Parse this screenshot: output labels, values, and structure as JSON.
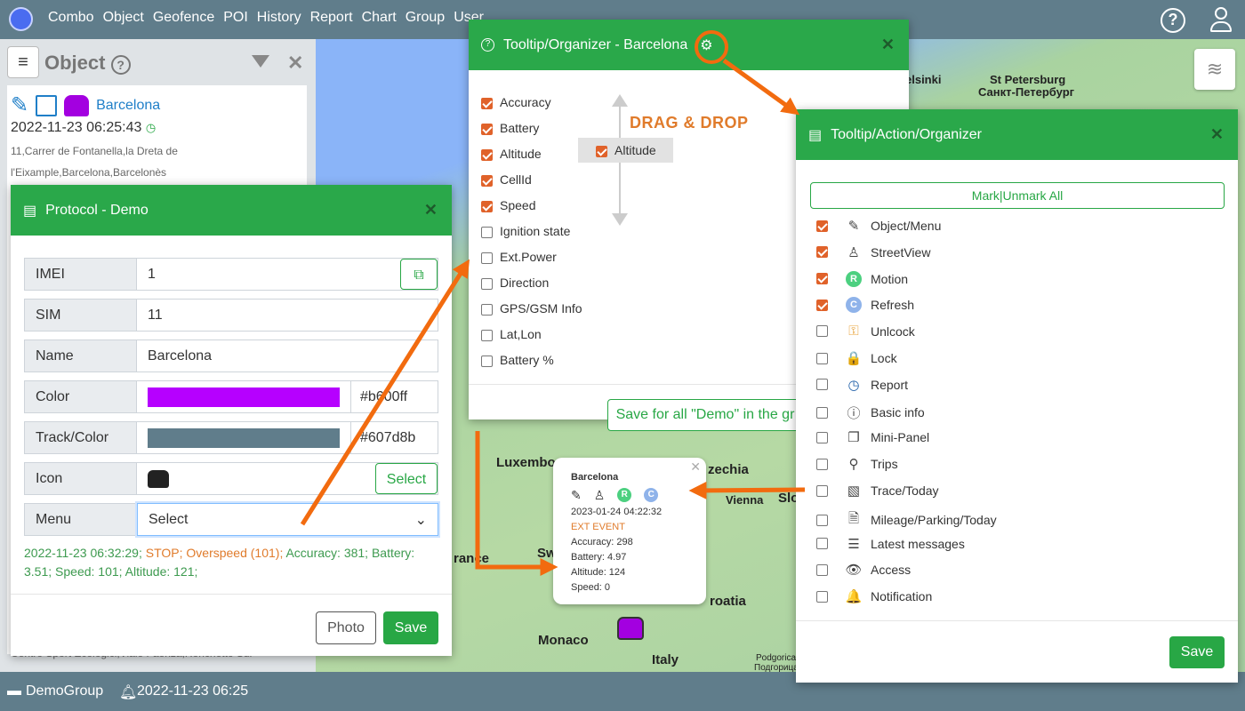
{
  "topbar": {
    "nav": [
      "Combo",
      "Object",
      "Geofence",
      "POI",
      "History",
      "Report",
      "Chart",
      "Group",
      "User"
    ]
  },
  "left": {
    "title": "Object",
    "object_name": "Barcelona",
    "object_time": "2022-11-23 06:25:43",
    "address": "11,Carrer de Fontanella,la Dreta de l'Eixample,Barcelona,Barcelonès",
    "address2": "Centro Sport Ecologici,Viale Faenza,Ronchetto Sul"
  },
  "map": {
    "labels": [
      "elsinki",
      "St Petersburg",
      "Санкт-Петербург",
      "Luxembo",
      "zechia",
      "Vienna",
      "Slo",
      "Monaco",
      "Italy",
      "roatia",
      "Sw",
      "rance",
      "Podgorica",
      "Подгорица"
    ]
  },
  "protocol": {
    "title": "Protocol - Demo",
    "rows": [
      {
        "label": "IMEI",
        "value": "1"
      },
      {
        "label": "SIM",
        "value": "11"
      },
      {
        "label": "Name",
        "value": "Barcelona"
      },
      {
        "label": "Color",
        "value": "#b600ff",
        "swatch": "#b600ff"
      },
      {
        "label": "Track/Color",
        "value": "#607d8b",
        "swatch": "#607d8b"
      },
      {
        "label": "Icon",
        "button": "Select"
      },
      {
        "label": "Menu",
        "value": "Select"
      }
    ],
    "status_time": "2022-11-23 06:32:29;",
    "status_alert": "STOP; Overspeed (101);",
    "status_rest": "Accuracy: 381; Battery: 3.51; Speed: 101; Altitude: 121;",
    "photo": "Photo",
    "save": "Save"
  },
  "organizer": {
    "title": "Tooltip/Organizer - Barcelona",
    "drag_label": "DRAG & DROP",
    "drag_item": "Altitude",
    "items": [
      {
        "label": "Accuracy",
        "checked": true
      },
      {
        "label": "Battery",
        "checked": true
      },
      {
        "label": "Altitude",
        "checked": true
      },
      {
        "label": "CellId",
        "checked": true
      },
      {
        "label": "Speed",
        "checked": true
      },
      {
        "label": "Ignition state",
        "checked": false
      },
      {
        "label": "Ext.Power",
        "checked": false
      },
      {
        "label": "Direction",
        "checked": false
      },
      {
        "label": "GPS/GSM Info",
        "checked": false
      },
      {
        "label": "Lat,Lon",
        "checked": false
      },
      {
        "label": "Battery %",
        "checked": false
      }
    ],
    "save_all": "Save for all \"Demo\" in the gr"
  },
  "action": {
    "title": "Tooltip/Action/Organizer",
    "mark_all": "Mark|Unmark All",
    "save": "Save",
    "items": [
      {
        "label": "Object/Menu",
        "checked": true,
        "icon": "✎"
      },
      {
        "label": "StreetView",
        "checked": true,
        "icon": "♙"
      },
      {
        "label": "Motion",
        "checked": true,
        "icon": "R"
      },
      {
        "label": "Refresh",
        "checked": true,
        "icon": "C"
      },
      {
        "label": "Unlcock",
        "checked": false,
        "icon": "⚿"
      },
      {
        "label": "Lock",
        "checked": false,
        "icon": "🔒"
      },
      {
        "label": "Report",
        "checked": false,
        "icon": "◷"
      },
      {
        "label": "Basic info",
        "checked": false,
        "icon": "ⓘ"
      },
      {
        "label": "Mini-Panel",
        "checked": false,
        "icon": "❐"
      },
      {
        "label": "Trips",
        "checked": false,
        "icon": "⚲"
      },
      {
        "label": "Trace/Today",
        "checked": false,
        "icon": "▧"
      },
      {
        "label": "Mileage/Parking/Today",
        "checked": false,
        "icon": "🗎"
      },
      {
        "label": "Latest messages",
        "checked": false,
        "icon": "☰"
      },
      {
        "label": "Access",
        "checked": false,
        "icon": "👁"
      },
      {
        "label": "Notification",
        "checked": false,
        "icon": "🔔"
      }
    ]
  },
  "popup": {
    "name": "Barcelona",
    "time": "2023-01-24 04:22:32",
    "event": "EXT EVENT",
    "lines": [
      "Accuracy: 298",
      "Battery: 4.97",
      "Altitude: 124",
      "Speed: 0"
    ]
  },
  "bottom": {
    "group": "DemoGroup",
    "time": "2022-11-23 06:25"
  },
  "colors": {
    "green": "#2aa84a",
    "orange": "#f26b0f",
    "topbar": "#607d8b",
    "object_color": "#b600ff"
  }
}
